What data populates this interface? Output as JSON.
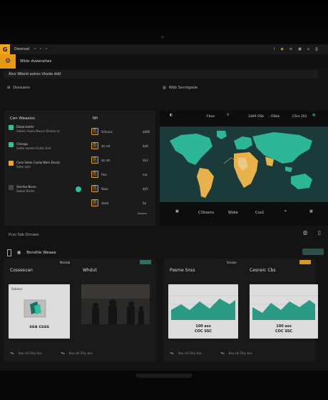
{
  "topbar": {
    "logo": "G",
    "title": "Dwonsel",
    "dots": "⚬ ⚬ ⚬",
    "icons": [
      "Ⅰ",
      "◉",
      "≡",
      "▣",
      "⌂",
      "⎙"
    ]
  },
  "subheader": {
    "icon": "⚙",
    "text": "Wkle dveeraties"
  },
  "titlebar": {
    "text": "Alvx Wbeld aolres Vkade ddd"
  },
  "section_left": {
    "label": "Osssuens"
  },
  "section_right": {
    "label": "Wbb Ssnntgosle"
  },
  "panel_left": {
    "title": "Cen Waaaiss",
    "rows": [
      {
        "l1": "Dsbanisiehe",
        "l2": "Sebaiu Soolu Nwuro Dlvaoe ec"
      },
      {
        "l1": "Ctassgu",
        "l2": "Sebie oeaeie Ooleis tisd"
      },
      {
        "l1": "Caeo Seloe Cuolw Ware Dscsls",
        "l2": "Sdbe oole"
      },
      {
        "l1": "Seivrbe Nsrse",
        "l2": "Seboe Bsstie"
      }
    ],
    "footer": "Daoees",
    "badge": "Cr"
  },
  "mid_col": {
    "header": "Nfi",
    "rows": [
      {
        "label": "Ssteuos",
        "value": "$$80"
      },
      {
        "label": "$$ ast",
        "value": "$$8"
      },
      {
        "label": "$$ ats",
        "value": "S$3"
      },
      {
        "label": "ttso",
        "value": "ss$"
      },
      {
        "label": "Sbas",
        "value": "$$5"
      },
      {
        "label": "$$ed",
        "value": "S$"
      }
    ]
  },
  "map": {
    "tabs": [
      "◧",
      "Fbee",
      "⚲",
      "2$89 OSb",
      "OSb$",
      "CSre 201",
      "▦"
    ],
    "footer": [
      "▣",
      "Cl3ssens",
      "Wsbe",
      "Cus1",
      "⚭",
      "▦"
    ]
  },
  "row_label": "Pcss Sob Onnees",
  "section2": {
    "title": "Bondtle Weaee"
  },
  "cards": [
    {
      "tag": "Nssdsb",
      "t1": "Cossesvan",
      "t2": "Whdut",
      "caption": "ssa csss",
      "foot": [
        "Bea sdl Dlsy bas"
      ],
      "thumb_text": "Sebieur"
    },
    {
      "tag": "Ssssoe",
      "t1": "Pasme Snss",
      "t2": "Cesneic Cbs",
      "caption": "100 ass",
      "caption2": "COC SSC",
      "foot": [
        "Bea sdl Dlsy bas"
      ]
    }
  ],
  "colors": {
    "accent": "#f0a51c",
    "teal": "#2fbf9c",
    "map_bg": "#1b3a3a"
  }
}
